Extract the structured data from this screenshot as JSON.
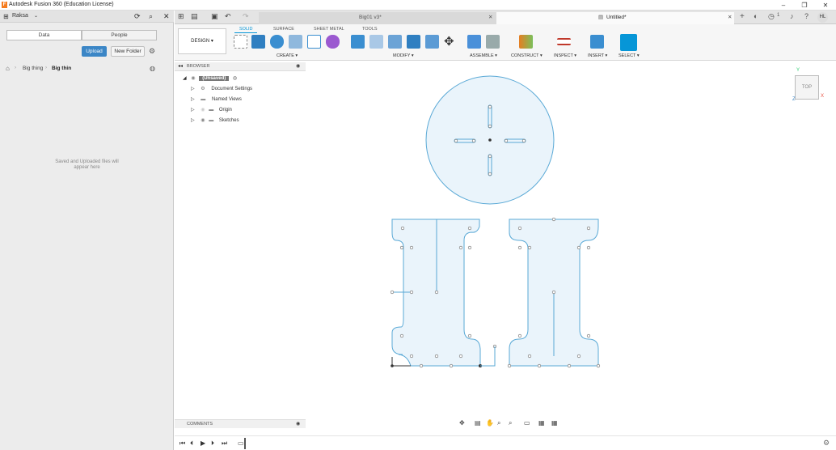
{
  "app": {
    "title": "Autodesk Fusion 360 (Education License)",
    "logo": "F"
  },
  "window_controls": {
    "minimize": "–",
    "maximize": "❐",
    "close": "✕"
  },
  "data_panel": {
    "user": "Raksa",
    "tabs": [
      "Data",
      "People"
    ],
    "upload_label": "Upload",
    "new_folder_label": "New Folder",
    "breadcrumb": [
      "Big thing",
      "Big thin"
    ],
    "empty_line1": "Saved and Uploaded files will",
    "empty_line2": "appear here"
  },
  "doc_tabs": [
    {
      "label": "Big01 v3*",
      "active": false
    },
    {
      "label": "Untitled*",
      "active": true
    }
  ],
  "toolbar": {
    "workspace": "DESIGN ▾",
    "tabs": [
      "SOLID",
      "SURFACE",
      "SHEET METAL",
      "TOOLS"
    ],
    "groups": [
      "CREATE ▾",
      "MODIFY ▾",
      "ASSEMBLE ▾",
      "CONSTRUCT ▾",
      "INSPECT ▾",
      "INSERT ▾",
      "SELECT ▾"
    ],
    "notification_count": "1",
    "user_initials": "HL"
  },
  "browser": {
    "header": "BROWSER",
    "root": "(Unsaved)",
    "items": [
      "Document Settings",
      "Named Views",
      "Origin",
      "Sketches"
    ]
  },
  "viewcube": {
    "face": "TOP",
    "axes": [
      "Y",
      "X",
      "Z"
    ]
  },
  "comments_label": "COMMENTS",
  "accent_color": "#0696d7",
  "sketch_color": "#5aa9d6"
}
